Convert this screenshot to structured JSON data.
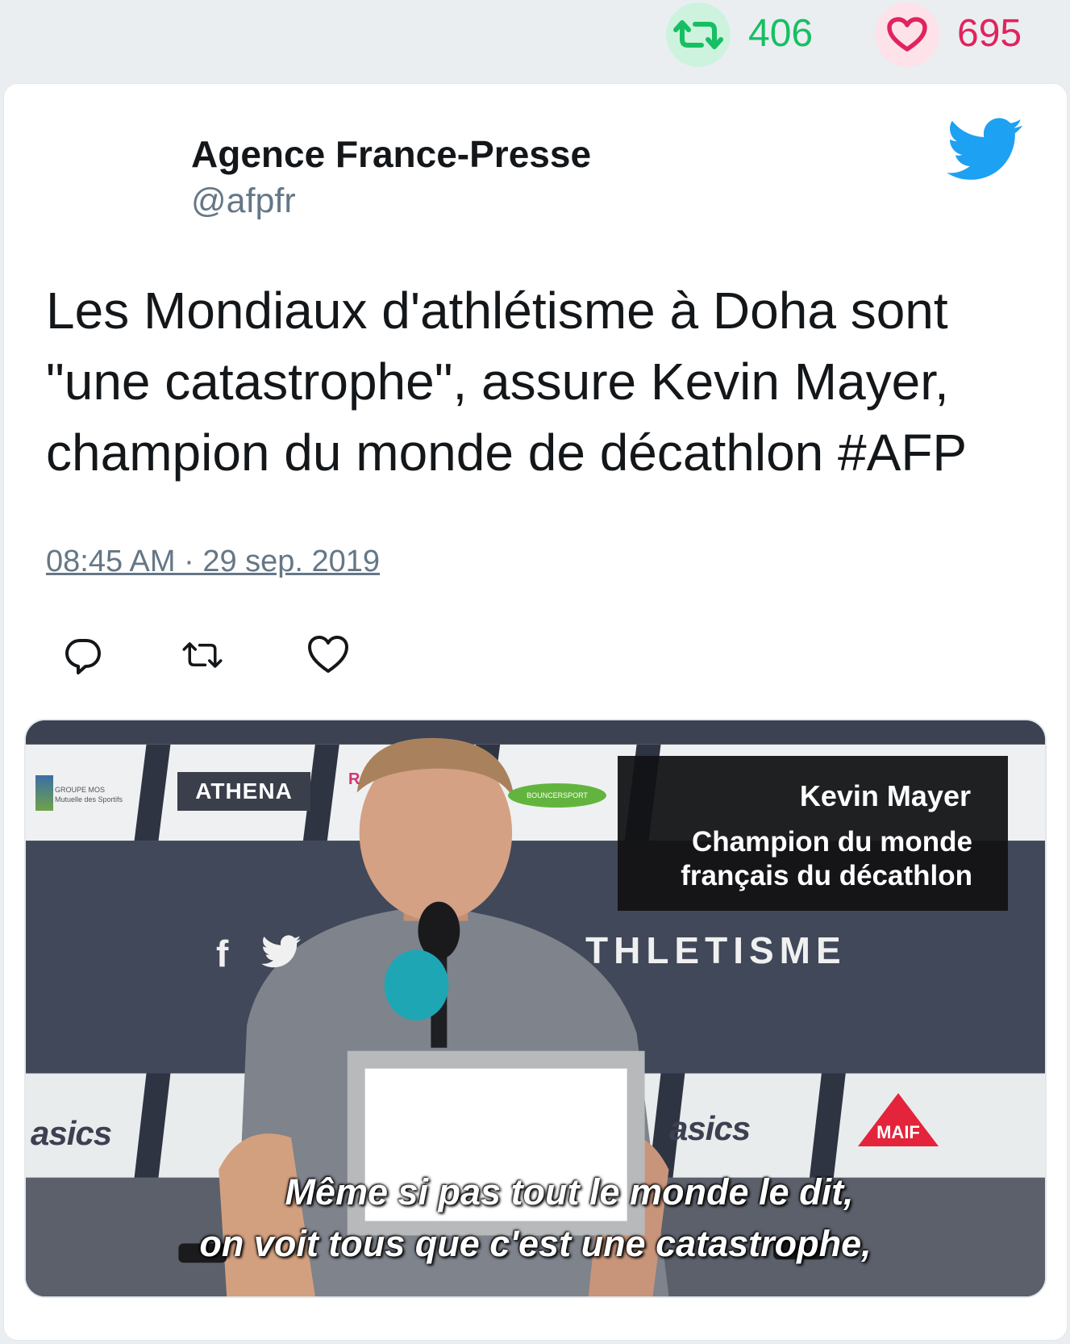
{
  "stats": {
    "retweet_icon": "retweet-icon",
    "retweet_count": "406",
    "retweet_color": "#17bf63",
    "like_icon": "heart-icon",
    "like_count": "695",
    "like_color": "#e0245e"
  },
  "tweet": {
    "author_name": "Agence France-Presse",
    "author_handle": "@afpfr",
    "brand_icon": "twitter-bird-icon",
    "brand_color": "#1da1f2",
    "text": "Les Mondiaux d'athlétisme à Doha sont \"une catastrophe\", assure Kevin Mayer, champion du monde de décathlon #AFP",
    "timestamp": "08:45 AM · 29 sep. 2019",
    "actions": {
      "reply_icon": "reply-icon",
      "retweet_icon": "retweet-icon",
      "like_icon": "heart-icon"
    }
  },
  "media": {
    "sponsor_athena": "ATHENA",
    "sponsor_groupe_title": "GROUPE MOS",
    "sponsor_groupe_sub": "Mutuelle des Sportifs",
    "sponsor_green": "BOUNCERSPORT",
    "sponsor_pink": "R",
    "caption_name": "Kevin Mayer",
    "caption_role_line1": "Champion du monde",
    "caption_role_line2": "français du décathlon",
    "backdrop_f": "f",
    "backdrop_text": "THLETISME",
    "asics_left": "asics",
    "asics_right": "asics",
    "maif": "MAIF",
    "subtitle_line1": "Même si pas tout le monde le dit,",
    "subtitle_line2": "on voit tous que c'est une catastrophe,"
  }
}
